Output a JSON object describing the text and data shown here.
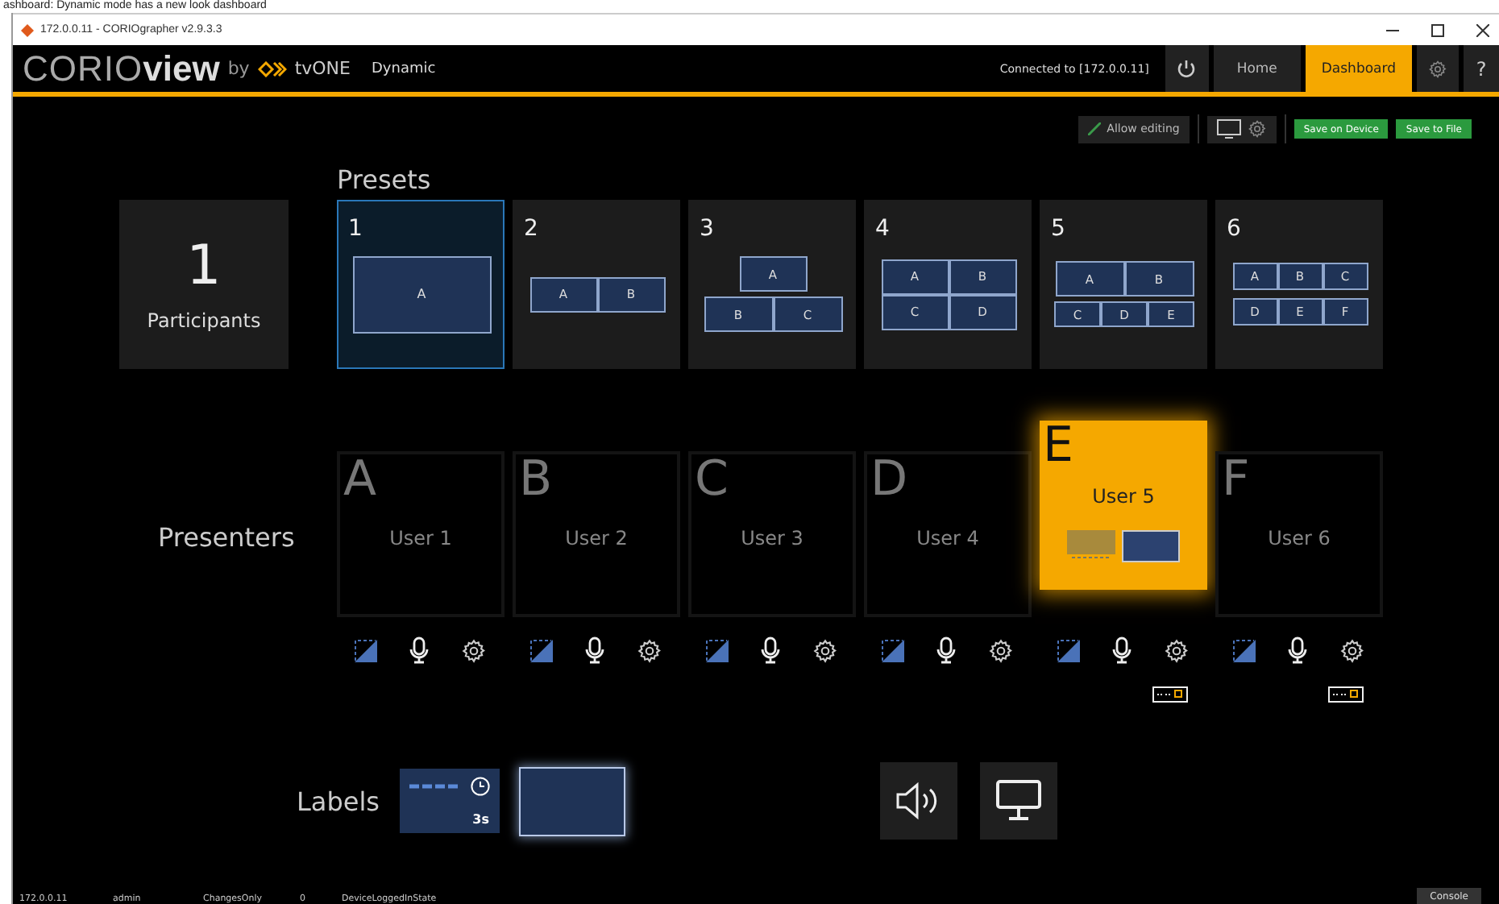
{
  "caption": "ashboard: Dynamic mode has a new look dashboard",
  "window": {
    "title": "172.0.0.11 - CORIOgrapher v2.9.3.3"
  },
  "header": {
    "logo_light": "CORIO",
    "logo_bold": "view",
    "by": "by",
    "brand": "tvONE",
    "mode": "Dynamic",
    "connection": "Connected to [172.0.0.11]",
    "nav": [
      {
        "label": "Home",
        "selected": false
      },
      {
        "label": "Dashboard",
        "selected": true
      }
    ],
    "help": "?"
  },
  "toolbar": {
    "allow_editing": "Allow editing",
    "save_device": "Save on Device",
    "save_file": "Save to File"
  },
  "participants": {
    "count": "1",
    "label": "Participants"
  },
  "presets": {
    "title": "Presets",
    "items": [
      {
        "number": "1",
        "selected": true,
        "rows": [
          [
            "A"
          ]
        ]
      },
      {
        "number": "2",
        "selected": false,
        "rows": [
          [
            "A",
            "B"
          ]
        ]
      },
      {
        "number": "3",
        "selected": false,
        "rows": [
          [
            "A"
          ],
          [
            "B",
            "C"
          ]
        ]
      },
      {
        "number": "4",
        "selected": false,
        "rows": [
          [
            "A",
            "B"
          ],
          [
            "C",
            "D"
          ]
        ]
      },
      {
        "number": "5",
        "selected": false,
        "rows": [
          [
            "A",
            "B"
          ],
          [
            "C",
            "D",
            "E"
          ]
        ]
      },
      {
        "number": "6",
        "selected": false,
        "rows": [
          [
            "A",
            "B",
            "C"
          ],
          [
            "D",
            "E",
            "F"
          ]
        ]
      }
    ]
  },
  "presenters": {
    "title": "Presenters",
    "items": [
      {
        "letter": "A",
        "user": "User 1",
        "selected": false,
        "device": false
      },
      {
        "letter": "B",
        "user": "User 2",
        "selected": false,
        "device": false
      },
      {
        "letter": "C",
        "user": "User 3",
        "selected": false,
        "device": false
      },
      {
        "letter": "D",
        "user": "User 4",
        "selected": false,
        "device": false
      },
      {
        "letter": "E",
        "user": "User 5",
        "selected": true,
        "device": true
      },
      {
        "letter": "F",
        "user": "User 6",
        "selected": false,
        "device": true
      }
    ]
  },
  "labels": {
    "title": "Labels",
    "items": [
      {
        "kind": "timer",
        "text": "3s",
        "selected": false
      },
      {
        "kind": "plain",
        "selected": true
      }
    ]
  },
  "status_bar": {
    "items": [
      "172.0.0.11",
      "admin",
      "ChangesOnly",
      "0",
      "DeviceLoggedInState"
    ],
    "console": "Console"
  }
}
